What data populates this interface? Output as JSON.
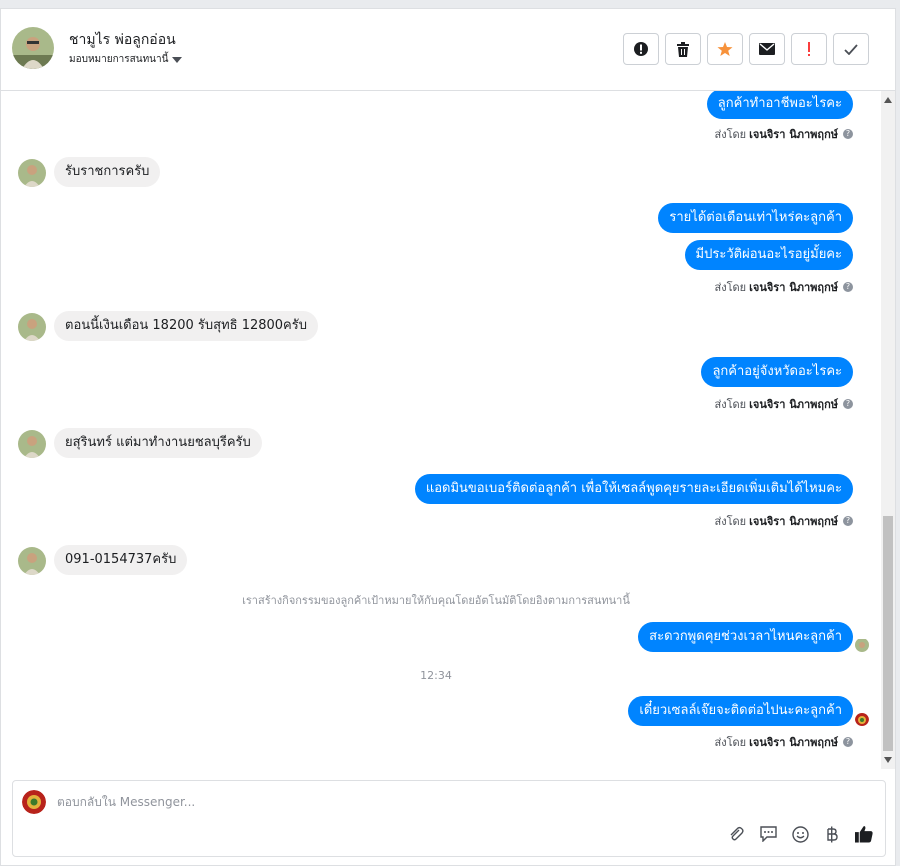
{
  "header": {
    "contact_name": "ชามูไร พ่อลูกอ่อน",
    "assign_label": "มอบหมายการสนทนานี้",
    "actions": [
      {
        "name": "mark-spam",
        "label": "!"
      },
      {
        "name": "delete",
        "label": "trash"
      },
      {
        "name": "star",
        "label": "star",
        "color": "#f7923b"
      },
      {
        "name": "unread",
        "label": "envelope"
      },
      {
        "name": "important",
        "label": "!",
        "color": "#fa3e3e"
      },
      {
        "name": "done",
        "label": "check"
      }
    ]
  },
  "thread": {
    "sender_prefix": "ส่งโดย",
    "sender_name": "เจนจิรา นิภาพฤกษ์",
    "messages": [
      {
        "dir": "out",
        "text": "ลูกค้าทำอาชีพอะไรคะ"
      },
      {
        "dir": "in",
        "text": "รับราชการครับ"
      },
      {
        "dir": "out",
        "text": "รายได้ต่อเดือนเท่าไหร่คะลูกค้า"
      },
      {
        "dir": "out",
        "text": "มีประวัติผ่อนอะไรอยู่มั้ยคะ"
      },
      {
        "dir": "in",
        "text": "ตอนนี้เงินเดือน 18200 รับสุทธิ 12800ครับ"
      },
      {
        "dir": "out",
        "text": "ลูกค้าอยู่จังหวัดอะไรคะ"
      },
      {
        "dir": "in",
        "text": "ยสุรินทร์ แต่มาทำงานยชลบุรีครับ"
      },
      {
        "dir": "out",
        "text": "แอดมินขอเบอร์ติดต่อลูกค้า เพื่อให้เซลล์พูดคุยรายละเอียดเพิ่มเติมได้ไหมคะ"
      },
      {
        "dir": "in",
        "text": "091-0154737ครับ"
      },
      {
        "dir": "out",
        "text": "สะดวกพูดคุยช่วงเวลาไหนคะลูกค้า"
      },
      {
        "dir": "out",
        "text": "เดี๋ยวเซลล์เจ๊ยจะติดต่อไปนะคะลูกค้า"
      }
    ],
    "system_note": "เราสร้างกิจกรรมของลูกค้าเป้าหมายให้กับคุณโดยอัตโนมัติโดยอิงตามการสนทนานี้",
    "timestamp": "12:34"
  },
  "composer": {
    "placeholder": "ตอบกลับใน Messenger..."
  },
  "colors": {
    "outgoing_bubble": "#0084ff",
    "incoming_bubble": "#f1f0f0",
    "star": "#f7923b",
    "important": "#fa3e3e"
  }
}
